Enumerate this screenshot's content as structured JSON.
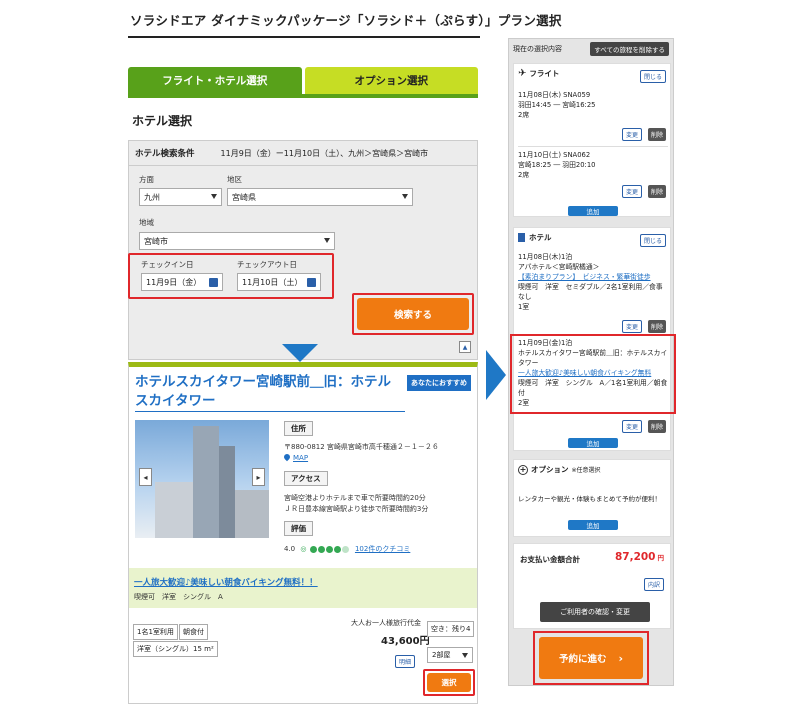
{
  "page_title": "ソラシドエア ダイナミックパッケージ「ソラシド＋（ぷらす）」プラン選択",
  "tabs": [
    {
      "label": "フライト・ホテル選択"
    },
    {
      "label": "オプション選択"
    }
  ],
  "section_title": "ホテル選択",
  "search": {
    "title": "ホテル検索条件",
    "summary": "11月9日（金）ー11月10日（土）、九州＞宮崎県＞宮崎市",
    "direction_label": "方面",
    "direction_value": "九州",
    "area_label": "地区",
    "area_value": "宮崎県",
    "region_label": "地域",
    "region_value": "宮崎市",
    "checkin_label": "チェックイン日",
    "checkin_value": "11月9日（金）",
    "checkout_label": "チェックアウト日",
    "checkout_value": "11月10日（土）",
    "search_button": "検索する"
  },
  "hotel": {
    "name": "ホテルスカイタワー宮崎駅前＿旧：ホテルスカイタワー",
    "badge": "あなたにおすすめ",
    "address_button": "住所",
    "address": "〒880-0812 宮崎県宮崎市高千穂通２－１－２６",
    "map_link": "MAP",
    "access_button": "アクセス",
    "access_line1": "宮崎空港よりホテルまで車で所要時間約20分",
    "access_line2": "ＪＲ日豊本線宮崎駅より徒歩で所要時間約3分",
    "review_button": "評価",
    "rating": "4.0",
    "review_link": "102件のクチコミ"
  },
  "plan": {
    "title": "一人旅大歓迎♪美味しい朝食バイキング無料！！",
    "subtitle": "喫煙可　洋室　シングル　A",
    "tag1": "1名1室利用",
    "tag2": "朝食付",
    "room_type": "洋室（シングル）15 m²",
    "price_label": "大人お一人様旅行代金",
    "price": "43,600円",
    "details_button": "明細",
    "availability": "空き：残り4",
    "rooms_select": "2部屋",
    "select_button": "選択"
  },
  "sidebar": {
    "header": "現在の選択内容",
    "clear_all": "すべての旅程を削除する",
    "flight_title": "フライト",
    "collapse": "閉じる",
    "flight1_line1": "11月08日(木) SNA059",
    "flight1_line2": "羽田14:45 ― 宮崎16:25",
    "flight1_line3": "2席",
    "flight2_line1": "11月10日(土) SNA062",
    "flight2_line2": "宮崎18:25 ― 羽田20:10",
    "flight2_line3": "2席",
    "change": "変更",
    "delete": "削除",
    "add": "追加",
    "hotel_title": "ホテル",
    "hotel1_line1": "11月08日(木)1泊",
    "hotel1_line2": "アパホテル＜宮崎駅橘通＞",
    "hotel1_link": "【素泊まりプラン】　ビジネス・繁華街徒歩",
    "hotel1_line4": "喫煙可　洋室　セミダブル／2名1室利用／食事なし",
    "hotel1_line5": "1室",
    "hotel2_line1": "11月09日(金)1泊",
    "hotel2_line2": "ホテルスカイタワー宮崎駅前＿旧：ホテルスカイタワー",
    "hotel2_link": "一人旅大歓迎♪美味しい朝食バイキング無料",
    "hotel2_line4": "喫煙可　洋室　シングル　A／1名1室利用／朝食付",
    "hotel2_line5": "2室",
    "option_title": "オプション",
    "option_note": "※任意選択",
    "option_text": "レンタカーや観光・体験もまとめて予約が便利！",
    "total_label": "お支払い金額合計",
    "total_value": "87,200",
    "total_unit": "円",
    "detail": "内訳",
    "confirm_button": "ご利用者の確認・変更",
    "proceed_button": "予約に進む"
  }
}
